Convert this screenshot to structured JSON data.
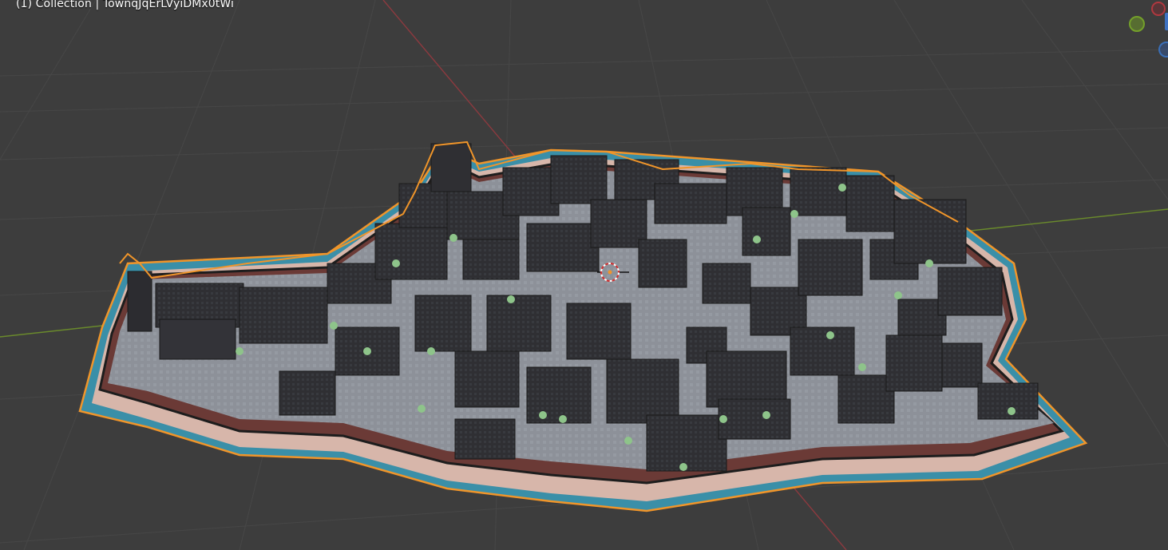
{
  "viewport": {
    "header_text": "(1) Collection | TownqJqErLVyiDMx0tWi",
    "background_color": "#3d3d3d",
    "grid_color": "#4a4a4a",
    "x_axis_color": "#8c3a3f",
    "y_axis_color": "#6a8a2c",
    "selection_outline_color": "#f0952a",
    "water_color": "#3a8fa8"
  },
  "gizmo": {
    "x_icon": "x-axis-circle-icon",
    "y_icon": "y-axis-circle-icon",
    "z_icon": "z-axis-circle-icon"
  },
  "scene": {
    "object_name": "TownqJqErLVyiDMx0tWi",
    "cursor_icon": "3d-cursor-icon"
  }
}
